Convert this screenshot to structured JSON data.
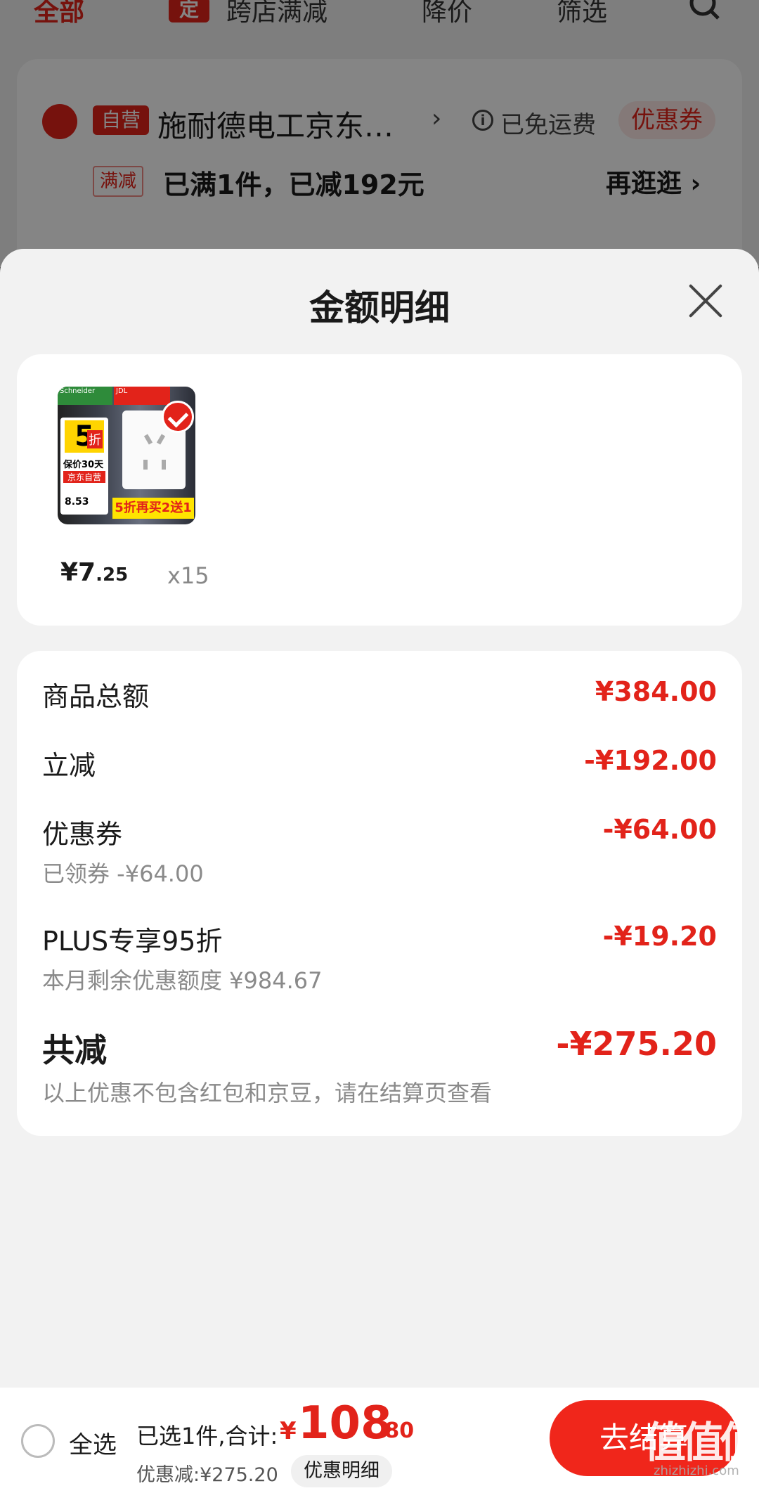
{
  "background": {
    "tabs": {
      "all": "全部",
      "cross_store_tag": "定",
      "cross_store": "跨店满减",
      "price_drop": "降价",
      "filter": "筛选"
    },
    "shop": {
      "self_run_tag": "自营",
      "name": "施耐德电工京东…",
      "shipping": "已免运费",
      "coupon": "优惠券",
      "promo_tag": "满减",
      "promo_text": "已满1件，已减192元",
      "browse_more": "再逛逛 ›"
    }
  },
  "sheet": {
    "title": "金额明细",
    "product": {
      "price_int": "¥7",
      "price_dec": ".25",
      "qty": "x15",
      "image": {
        "brand": "Schneider",
        "jdl": "JDL",
        "discount": "5",
        "discount_unit": "折",
        "guarantee": "保价30天",
        "jd_self": "京东自营",
        "price": "8.53",
        "banner": "5折再买2送1"
      }
    },
    "details": {
      "goods_total": {
        "label": "商品总额",
        "value": "¥384.00"
      },
      "instant_off": {
        "label": "立减",
        "value": "-¥192.00"
      },
      "coupon": {
        "label": "优惠券",
        "sub": "已领券 -¥64.00",
        "value": "-¥64.00"
      },
      "plus": {
        "label": "PLUS专享95折",
        "sub": "本月剩余优惠额度 ¥984.67",
        "value": "-¥19.20"
      },
      "total_off": {
        "label": "共减",
        "sub": "以上优惠不包含红包和京豆，请在结算页查看",
        "value": "-¥275.20"
      }
    }
  },
  "bottom": {
    "select_all": "全选",
    "summary": "已选1件,合计:",
    "currency": "¥",
    "total_int": "108",
    "total_dec": ".80",
    "discount": "优惠减:¥275.20",
    "detail_button": "优惠明细",
    "checkout": "去结算",
    "watermark": "值值值",
    "watermark_sub": "zhizhizhi.com"
  },
  "colors": {
    "accent": "#e2231a",
    "sheet_bg": "#f2f2f2",
    "checkout": "#f0261b"
  }
}
